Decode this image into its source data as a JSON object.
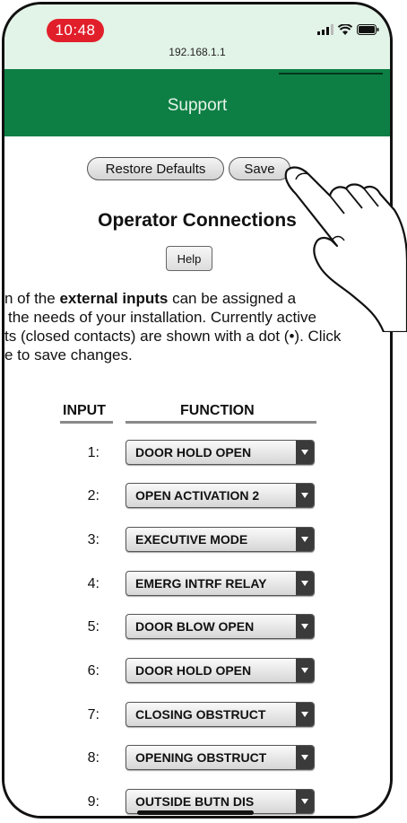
{
  "status_bar": {
    "time": "10:48",
    "url": "192.168.1.1"
  },
  "header": {
    "title": "Support"
  },
  "buttons": {
    "restore": "Restore Defaults",
    "save": "Save",
    "help": "Help"
  },
  "page_title": "Operator Connections",
  "intro": {
    "line1_a": "n of the ",
    "line1_b": "external inputs",
    "line1_c": " can be assigned a",
    "line2": "the needs of your installation. Currently active",
    "line3": "ts (closed contacts) are shown with a dot (•). Click",
    "line4": "e to save changes."
  },
  "table": {
    "headers": {
      "input": "INPUT",
      "function": "FUNCTION"
    },
    "rows": [
      {
        "input": "1:",
        "function": "DOOR HOLD OPEN"
      },
      {
        "input": "2:",
        "function": "OPEN ACTIVATION 2"
      },
      {
        "input": "3:",
        "function": "EXECUTIVE MODE"
      },
      {
        "input": "4:",
        "function": "EMERG INTRF RELAY"
      },
      {
        "input": "5:",
        "function": "DOOR BLOW OPEN"
      },
      {
        "input": "6:",
        "function": "DOOR HOLD OPEN"
      },
      {
        "input": "7:",
        "function": "CLOSING OBSTRUCT"
      },
      {
        "input": "8:",
        "function": "OPENING OBSTRUCT"
      },
      {
        "input": "9:",
        "function": "OUTSIDE BUTN DIS"
      }
    ]
  },
  "colors": {
    "header_green": "#0d7f44",
    "status_bg": "#e2f3e7",
    "time_pill": "#e11f2b"
  },
  "icons": [
    "signal-icon",
    "wifi-icon",
    "battery-icon",
    "pointing-hand-icon",
    "dropdown-arrow-icon"
  ]
}
